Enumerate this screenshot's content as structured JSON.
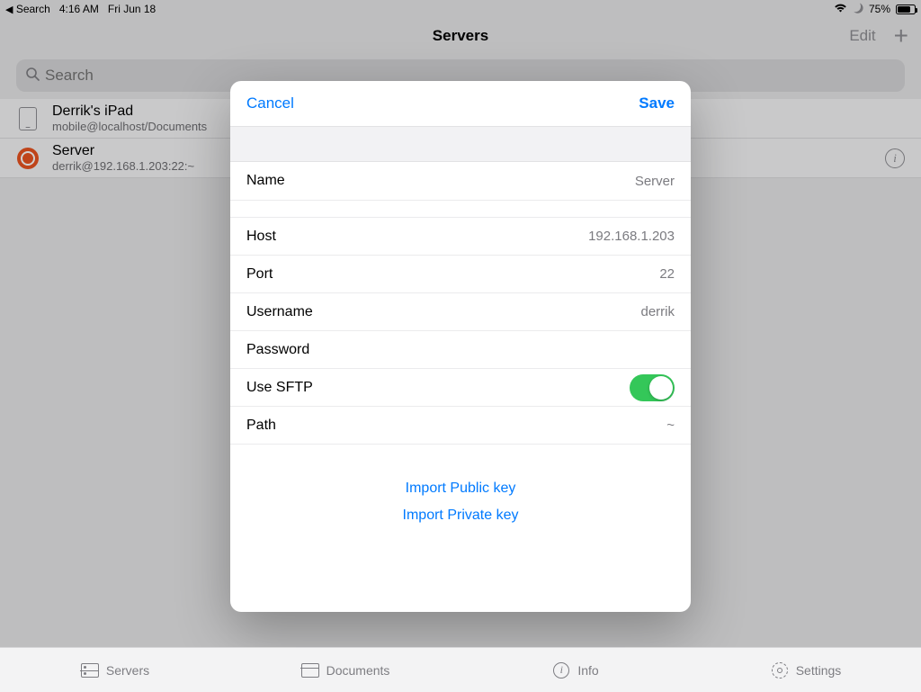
{
  "statusbar": {
    "back_app": "Search",
    "time": "4:16 AM",
    "date": "Fri Jun 18",
    "battery_pct": "75%"
  },
  "nav": {
    "title": "Servers",
    "edit": "Edit"
  },
  "search": {
    "placeholder": "Search"
  },
  "servers": [
    {
      "title": "Derrik's iPad",
      "subtitle": "mobile@localhost/Documents",
      "icon": "ipad",
      "info": false
    },
    {
      "title": "Server",
      "subtitle": "derrik@192.168.1.203:22:~",
      "icon": "ubuntu",
      "info": true
    }
  ],
  "modal": {
    "cancel": "Cancel",
    "save": "Save",
    "fields": {
      "name_label": "Name",
      "name_value": "Server",
      "host_label": "Host",
      "host_value": "192.168.1.203",
      "port_label": "Port",
      "port_value": "22",
      "username_label": "Username",
      "username_value": "derrik",
      "password_label": "Password",
      "password_value": "",
      "sftp_label": "Use SFTP",
      "sftp_on": true,
      "path_label": "Path",
      "path_value": "~"
    },
    "import_public": "Import Public key",
    "import_private": "Import Private key"
  },
  "tabs": {
    "servers": "Servers",
    "documents": "Documents",
    "info": "Info",
    "settings": "Settings"
  }
}
